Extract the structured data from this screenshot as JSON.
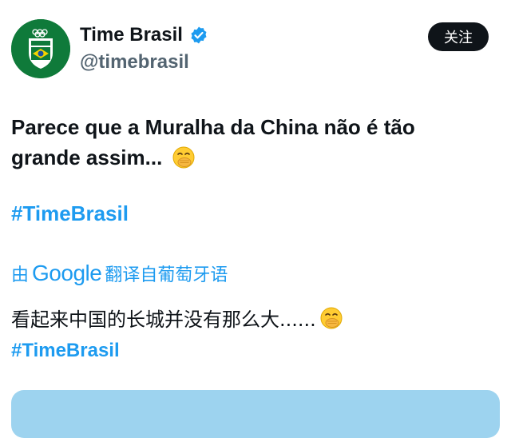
{
  "profile": {
    "name": "Time Brasil",
    "handle": "@timebrasil",
    "follow_label": "关注"
  },
  "tweet": {
    "text_line1": "Parece que a Muralha da China não é tão",
    "text_line2": "grande assim...",
    "hashtag": "#TimeBrasil"
  },
  "translation": {
    "prefix": "由",
    "google": "Google",
    "suffix": "翻译自葡萄牙语",
    "text": "看起来中国的长城并没有那么大......",
    "hashtag": "#TimeBrasil"
  },
  "icons": {
    "verified": "verified-badge-icon",
    "emoji": "face-with-hand-over-mouth-emoji"
  },
  "colors": {
    "accent": "#1d9bf0",
    "avatar_bg": "#0f7a3a",
    "follow_bg": "#0f1419",
    "media_bg": "#9dd3ef"
  }
}
